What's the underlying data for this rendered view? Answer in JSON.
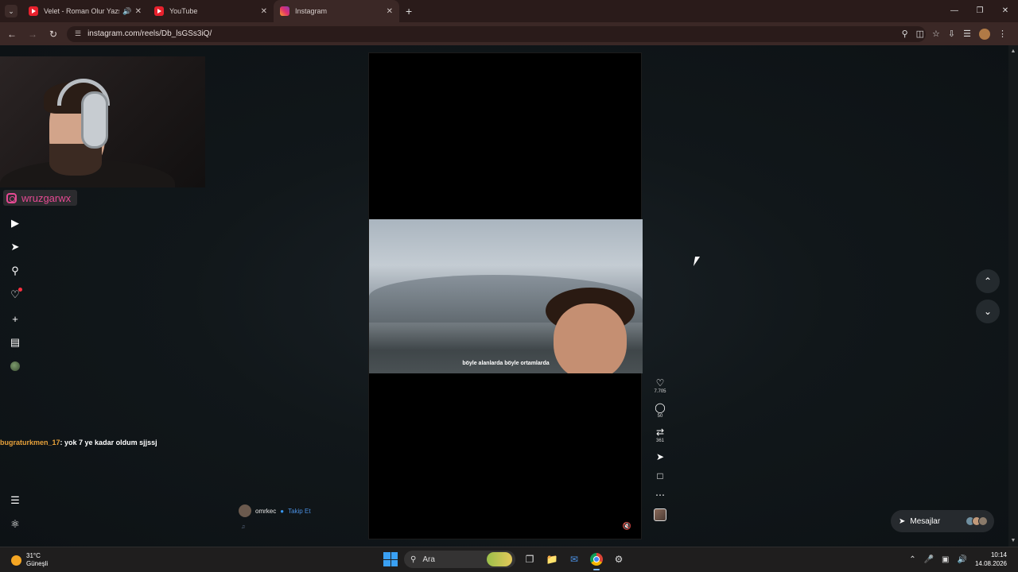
{
  "browser": {
    "tabs": [
      {
        "title": "Velet - Roman Olur Yazsam",
        "favicon": "youtube",
        "audio": true,
        "active": false
      },
      {
        "title": "YouTube",
        "favicon": "youtube",
        "audio": false,
        "active": false
      },
      {
        "title": "Instagram",
        "favicon": "instagram",
        "audio": false,
        "active": true
      }
    ],
    "url": "instagram.com/reels/Db_lsGSs3iQ/"
  },
  "stream": {
    "instagram_handle": "wruzgarwx",
    "chat_message": {
      "user": "bugraturkmen_17",
      "text": ": yok 7 ye kadar oldum sjjssj"
    }
  },
  "reel": {
    "subtitle": "böyle alanlarda böyle ortamlarda",
    "author": "omrkec",
    "follow_label": "Takip Et",
    "likes": "7.705",
    "comments": "50",
    "reposts": "361"
  },
  "messages_label": "Mesajlar",
  "taskbar": {
    "temperature": "31°C",
    "weather": "Güneşli",
    "search_placeholder": "Ara",
    "time": "10:14",
    "date": "14.08.2026"
  },
  "colors": {
    "accent_instagram": "#e54a93",
    "chat_user": "#e7a13a",
    "verified": "#3897f0"
  }
}
